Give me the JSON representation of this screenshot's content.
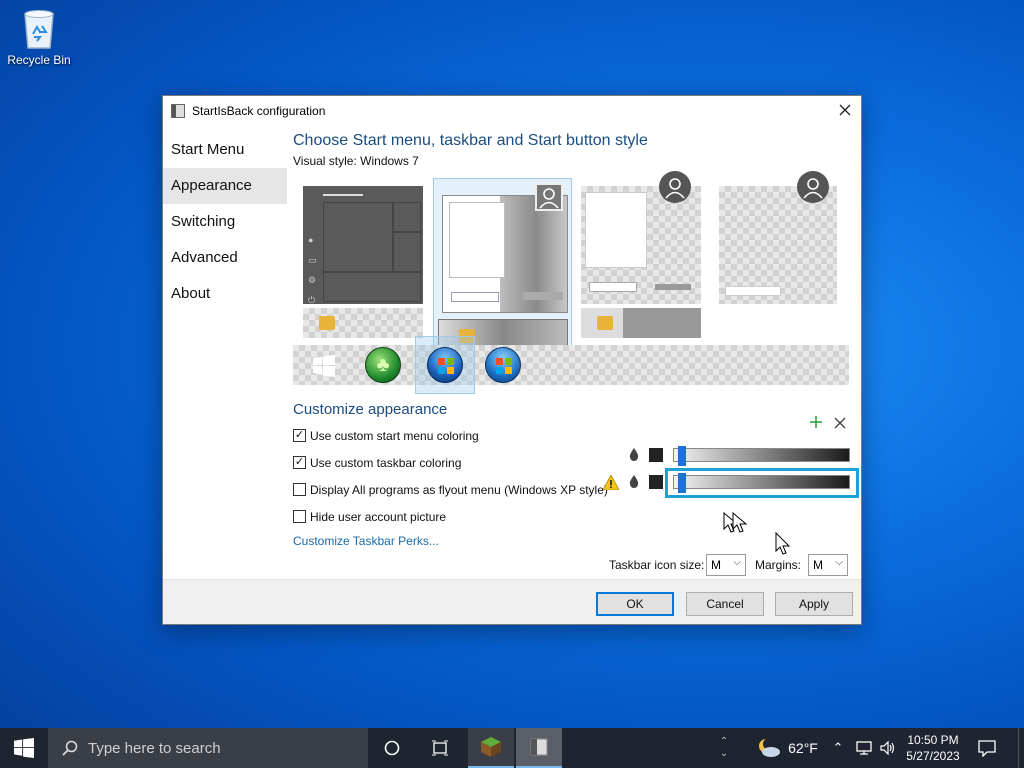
{
  "desktop": {
    "recycle_bin_label": "Recycle Bin"
  },
  "window": {
    "title": "StartIsBack configuration",
    "nav": [
      {
        "label": "Start Menu",
        "active": false
      },
      {
        "label": "Appearance",
        "active": true
      },
      {
        "label": "Switching",
        "active": false
      },
      {
        "label": "Advanced",
        "active": false
      },
      {
        "label": "About",
        "active": false
      }
    ],
    "style_heading": "Choose Start menu, taskbar and Start button style",
    "visual_style_label": "Visual style:",
    "visual_style_value": "Windows 7",
    "customize_heading": "Customize appearance",
    "options": [
      {
        "label": "Use custom start menu coloring",
        "checked": true
      },
      {
        "label": "Use custom taskbar coloring",
        "checked": true
      },
      {
        "label": "Display All programs as flyout menu (Windows XP style)",
        "checked": false
      },
      {
        "label": "Hide user account picture",
        "checked": false
      }
    ],
    "perks_link": "Customize Taskbar Perks...",
    "taskbar_icon_size_label": "Taskbar icon size:",
    "taskbar_icon_size_value": "M",
    "margins_label": "Margins:",
    "margins_value": "M",
    "buttons": {
      "ok": "OK",
      "cancel": "Cancel",
      "apply": "Apply"
    },
    "accent_color": "#0078d7",
    "highlight_color": "#1ba3d9"
  },
  "taskbar": {
    "search_placeholder": "Type here to search",
    "temperature": "62°F",
    "time": "10:50 PM",
    "date": "5/27/2023"
  }
}
